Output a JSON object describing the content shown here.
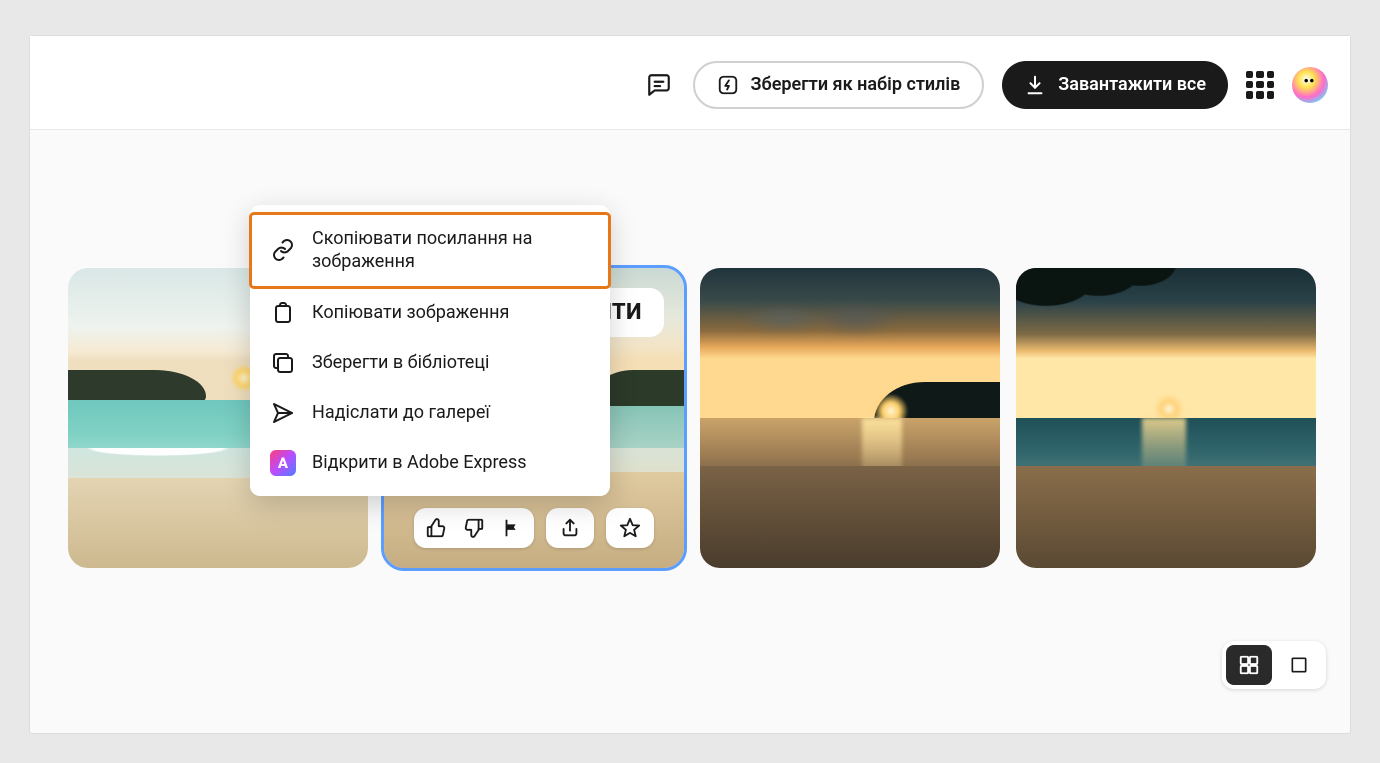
{
  "header": {
    "save_styles_label": "Зберегти як набір стилів",
    "download_all_label": "Завантажити все"
  },
  "thumb_overlay": {
    "edit_button_suffix": "ЖИТИ"
  },
  "context_menu": {
    "copy_link_label": "Скопіювати посилання на зображення",
    "copy_image_label": "Копіювати зображення",
    "save_library_label": "Зберегти в бібліотеці",
    "send_gallery_label": "Надіслати до галереї",
    "open_express_label": "Відкрити в Adobe Express",
    "express_badge_letter": "A"
  }
}
